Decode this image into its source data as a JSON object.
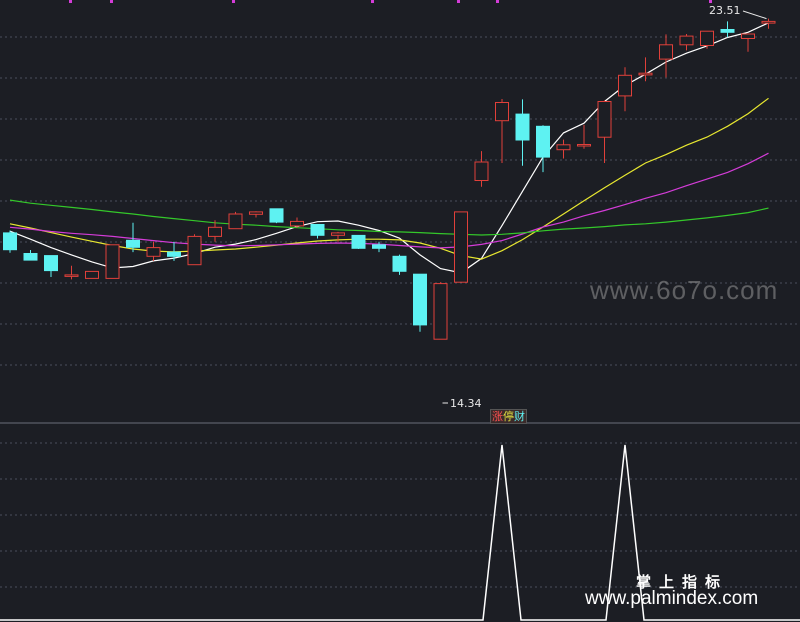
{
  "chart_data": [
    {
      "type": "candlestick",
      "title": "",
      "colors": {
        "up": "#e0403a",
        "down": "#5ef2f2",
        "ma5": "#ffffff",
        "ma10": "#e8e830",
        "ma20": "#d43cd8",
        "ma60": "#34c82a",
        "grid": "#4a4f5c",
        "background": "#1c1e24"
      },
      "y_range": [
        12.6,
        23.9
      ],
      "candles": [
        {
          "o": 17.38,
          "h": 17.45,
          "l": 16.81,
          "c": 16.9
        },
        {
          "o": 16.79,
          "h": 16.89,
          "l": 16.6,
          "c": 16.6
        },
        {
          "o": 16.73,
          "h": 16.73,
          "l": 16.12,
          "c": 16.3
        },
        {
          "o": 16.18,
          "h": 16.44,
          "l": 16.05,
          "c": 16.18
        },
        {
          "o": 16.08,
          "h": 16.28,
          "l": 16.08,
          "c": 16.28
        },
        {
          "o": 16.08,
          "h": 17.04,
          "l": 16.08,
          "c": 17.04
        },
        {
          "o": 17.17,
          "h": 17.67,
          "l": 16.83,
          "c": 16.97
        },
        {
          "o": 16.71,
          "h": 17.13,
          "l": 16.58,
          "c": 16.96
        },
        {
          "o": 16.83,
          "h": 17.13,
          "l": 16.58,
          "c": 16.71
        },
        {
          "o": 16.47,
          "h": 17.34,
          "l": 16.47,
          "c": 17.28
        },
        {
          "o": 17.28,
          "h": 17.74,
          "l": 17.13,
          "c": 17.54
        },
        {
          "o": 17.5,
          "h": 17.98,
          "l": 17.5,
          "c": 17.92
        },
        {
          "o": 17.91,
          "h": 18.0,
          "l": 17.82,
          "c": 17.98
        },
        {
          "o": 18.07,
          "h": 18.07,
          "l": 17.66,
          "c": 17.69
        },
        {
          "o": 17.58,
          "h": 17.82,
          "l": 17.53,
          "c": 17.71
        },
        {
          "o": 17.62,
          "h": 17.62,
          "l": 17.22,
          "c": 17.31
        },
        {
          "o": 17.31,
          "h": 17.41,
          "l": 17.13,
          "c": 17.38
        },
        {
          "o": 17.31,
          "h": 17.31,
          "l": 16.92,
          "c": 16.94
        },
        {
          "o": 17.04,
          "h": 17.13,
          "l": 16.83,
          "c": 16.94
        },
        {
          "o": 16.71,
          "h": 16.76,
          "l": 16.18,
          "c": 16.28
        },
        {
          "o": 16.2,
          "h": 16.2,
          "l": 14.55,
          "c": 14.75
        },
        {
          "o": 14.34,
          "h": 15.97,
          "l": 14.34,
          "c": 15.93
        },
        {
          "o": 15.97,
          "h": 17.98,
          "l": 15.97,
          "c": 17.98
        },
        {
          "o": 18.88,
          "h": 19.72,
          "l": 18.7,
          "c": 19.41
        },
        {
          "o": 20.59,
          "h": 21.21,
          "l": 19.38,
          "c": 21.11
        },
        {
          "o": 20.78,
          "h": 21.2,
          "l": 19.3,
          "c": 20.04
        },
        {
          "o": 20.43,
          "h": 20.46,
          "l": 19.12,
          "c": 19.55
        },
        {
          "o": 19.76,
          "h": 20.05,
          "l": 19.51,
          "c": 19.9
        },
        {
          "o": 19.88,
          "h": 20.47,
          "l": 19.79,
          "c": 19.91
        },
        {
          "o": 20.12,
          "h": 21.17,
          "l": 19.38,
          "c": 21.14
        },
        {
          "o": 21.3,
          "h": 22.12,
          "l": 20.86,
          "c": 21.89
        },
        {
          "o": 21.9,
          "h": 22.4,
          "l": 21.72,
          "c": 21.95
        },
        {
          "o": 22.35,
          "h": 23.06,
          "l": 21.83,
          "c": 22.76
        },
        {
          "o": 22.76,
          "h": 23.07,
          "l": 22.6,
          "c": 23.01
        },
        {
          "o": 22.74,
          "h": 23.04,
          "l": 22.65,
          "c": 23.15
        },
        {
          "o": 23.2,
          "h": 23.43,
          "l": 22.98,
          "c": 23.12
        },
        {
          "o": 22.94,
          "h": 23.04,
          "l": 22.56,
          "c": 23.07
        },
        {
          "o": 23.38,
          "h": 23.51,
          "l": 23.22,
          "c": 23.43
        }
      ],
      "ma_lines": [
        {
          "key": "ma5",
          "values": [
            17.43,
            17.2,
            16.96,
            16.75,
            16.55,
            16.38,
            16.42,
            16.58,
            16.66,
            16.79,
            16.97,
            17.06,
            17.19,
            17.37,
            17.56,
            17.7,
            17.72,
            17.6,
            17.45,
            17.23,
            16.75,
            16.36,
            16.24,
            16.65,
            17.59,
            18.57,
            19.55,
            20.24,
            20.52,
            21.14,
            21.6,
            21.92,
            22.27,
            22.52,
            22.73,
            22.97,
            23.12,
            23.39
          ]
        },
        {
          "key": "ma10",
          "values": [
            17.64,
            17.52,
            17.39,
            17.26,
            17.14,
            17.02,
            16.92,
            16.86,
            16.84,
            16.86,
            16.89,
            16.92,
            16.97,
            17.03,
            17.09,
            17.15,
            17.18,
            17.2,
            17.2,
            17.18,
            17.09,
            16.94,
            16.73,
            16.63,
            16.87,
            17.19,
            17.55,
            17.92,
            18.3,
            18.67,
            19.03,
            19.38,
            19.62,
            19.89,
            20.12,
            20.43,
            20.79,
            21.23
          ]
        },
        {
          "key": "ma20",
          "values": [
            17.54,
            17.49,
            17.42,
            17.37,
            17.33,
            17.28,
            17.22,
            17.16,
            17.1,
            17.06,
            17.03,
            17.01,
            17.02,
            17.04,
            17.06,
            17.08,
            17.09,
            17.08,
            17.06,
            17.02,
            16.98,
            16.95,
            16.98,
            17.05,
            17.16,
            17.35,
            17.55,
            17.69,
            17.87,
            18.02,
            18.19,
            18.37,
            18.53,
            18.73,
            18.92,
            19.11,
            19.36,
            19.66
          ]
        },
        {
          "key": "ma60",
          "values": [
            18.32,
            18.23,
            18.17,
            18.11,
            18.05,
            17.98,
            17.92,
            17.85,
            17.79,
            17.73,
            17.67,
            17.63,
            17.6,
            17.56,
            17.53,
            17.5,
            17.47,
            17.45,
            17.42,
            17.41,
            17.39,
            17.36,
            17.34,
            17.32,
            17.34,
            17.38,
            17.44,
            17.49,
            17.52,
            17.56,
            17.61,
            17.64,
            17.69,
            17.75,
            17.81,
            17.88,
            17.96,
            18.09
          ]
        }
      ],
      "annotations": {
        "max_label": "23.51",
        "min_label": "14.34",
        "signal_tag": {
          "part1": "涨",
          "part2": "停",
          "part3": "财"
        }
      }
    },
    {
      "type": "line",
      "title": "",
      "color": "#ffffff",
      "y_range": [
        0,
        1
      ],
      "values": [
        0,
        0,
        0,
        0,
        0,
        0,
        0,
        0,
        0,
        0,
        0,
        0,
        0,
        0,
        0,
        0,
        0,
        0,
        0,
        0,
        0,
        0,
        0,
        0,
        1,
        0,
        0,
        0,
        0,
        0,
        1,
        0,
        0,
        0,
        0,
        0,
        0,
        0
      ]
    }
  ],
  "watermark": {
    "site": "www.6o7o.com",
    "brand_zh": "掌上指标",
    "brand_url": "www.palmindex.com"
  }
}
